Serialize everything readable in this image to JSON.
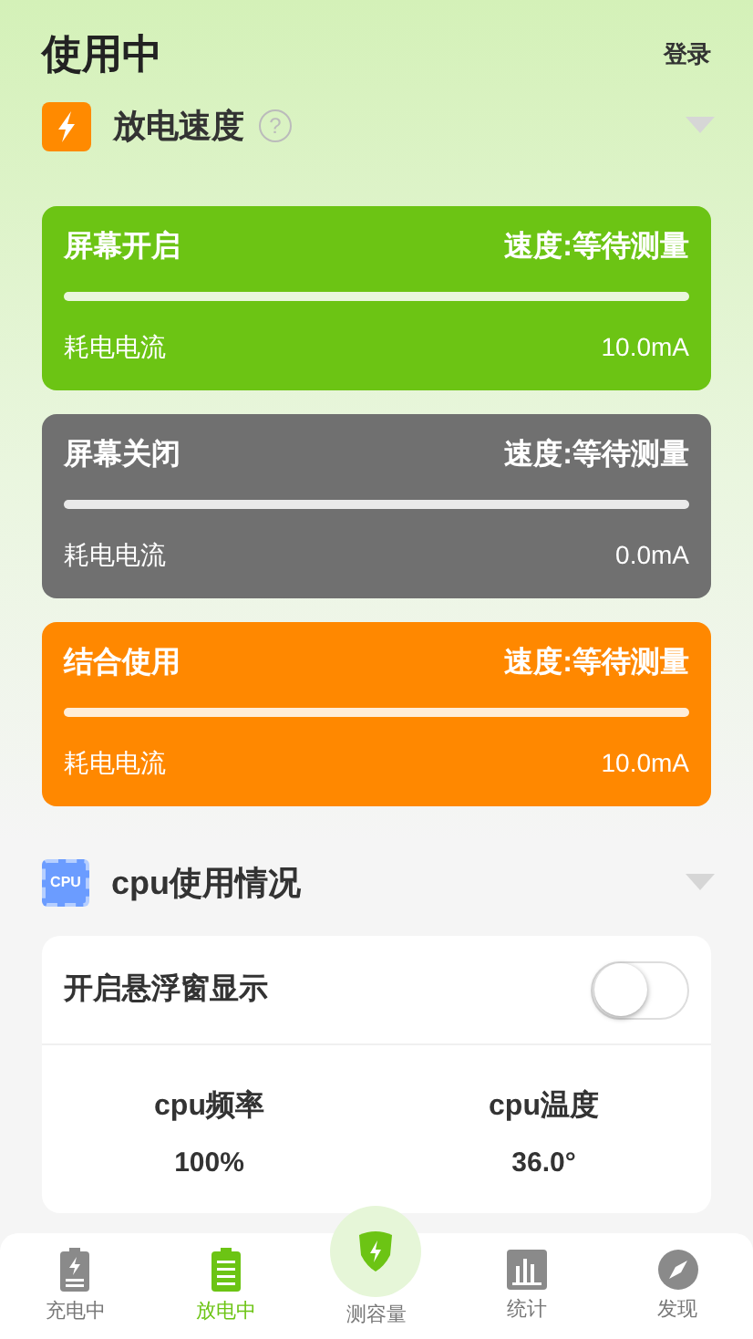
{
  "header": {
    "title": "使用中",
    "login": "登录"
  },
  "discharge_section": {
    "title": "放电速度",
    "help": "?",
    "expanded": true
  },
  "cards": [
    {
      "title": "屏幕开启",
      "speed": "速度:等待测量",
      "label": "耗电电流",
      "value": "10.0mA",
      "color": "#6cc414"
    },
    {
      "title": "屏幕关闭",
      "speed": "速度:等待测量",
      "label": "耗电电流",
      "value": "0.0mA",
      "color": "#707070"
    },
    {
      "title": "结合使用",
      "speed": "速度:等待测量",
      "label": "耗电电流",
      "value": "10.0mA",
      "color": "#ff8800"
    }
  ],
  "cpu_section": {
    "icon_text": "CPU",
    "title": "cpu使用情况",
    "expanded": true
  },
  "floating_window": {
    "label": "开启悬浮窗显示",
    "on": false
  },
  "stats": [
    {
      "label": "cpu频率",
      "value": "100%"
    },
    {
      "label": "cpu温度",
      "value": "36.0°"
    }
  ],
  "nav": [
    {
      "kind": "charge",
      "label": "充电中",
      "selected": false
    },
    {
      "kind": "discharge",
      "label": "放电中",
      "selected": true
    },
    {
      "kind": "measure",
      "label": "测容量",
      "selected": false
    },
    {
      "kind": "stats",
      "label": "统计",
      "selected": false
    },
    {
      "kind": "discover",
      "label": "发现",
      "selected": false
    }
  ]
}
